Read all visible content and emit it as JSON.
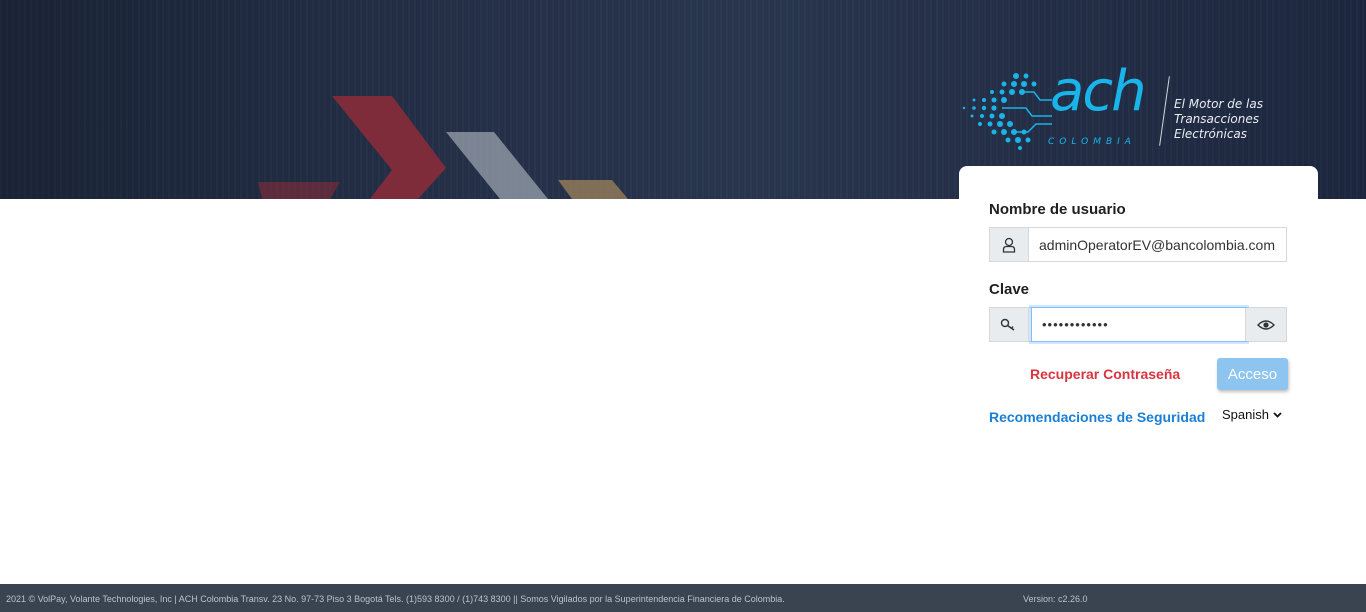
{
  "brand": {
    "logo_text": "ach",
    "logo_subtitle": "COLOMBIA",
    "tagline_lines": [
      "El Motor de las",
      "Transacciones",
      "Electrónicas"
    ],
    "accent_color": "#19b4ea"
  },
  "login": {
    "username_label": "Nombre de usuario",
    "username_value": "adminOperatorEV@bancolombia.com",
    "password_label": "Clave",
    "password_value": "••••••••••••",
    "user_icon": "user-icon",
    "key_icon": "key-icon",
    "eye_icon": "eye-icon",
    "recover_link": "Recuperar Contraseña",
    "submit_label": "Acceso",
    "security_link": "Recomendaciones de Seguridad",
    "language": "Spanish",
    "link_color_recover": "#d9343f",
    "link_color_security": "#1a7fd6"
  },
  "footer": {
    "text": "2021 © VolPay, Volante Technologies, Inc | ACH Colombia Transv. 23 No. 97-73 Piso 3 Bogotá Tels. (1)593 8300 / (1)743 8300 || Somos Vigilados por la Superintendencia Financiera de Colombia.",
    "version": "Version: c2.26.0"
  }
}
